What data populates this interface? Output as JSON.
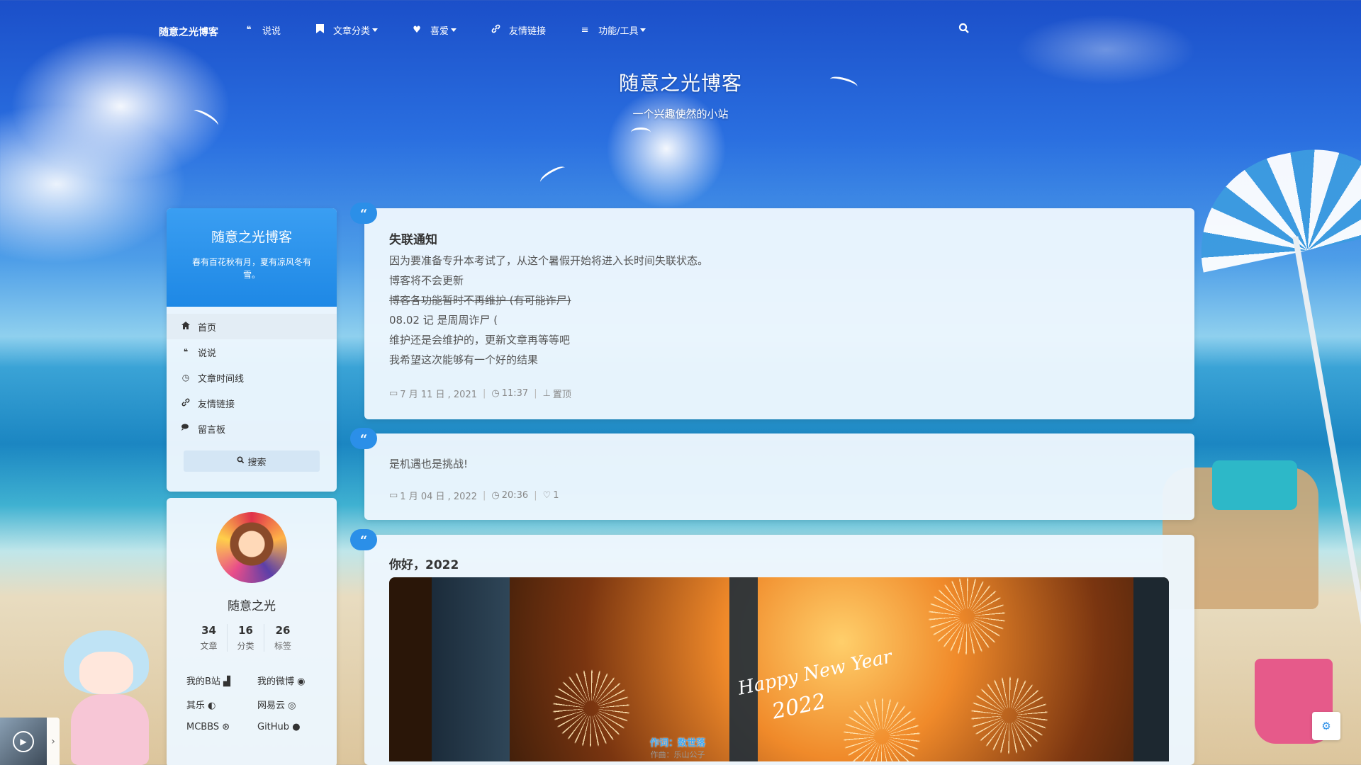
{
  "navbar": {
    "brand": "随意之光博客",
    "items": [
      {
        "label": "说说",
        "icon": "quote-icon",
        "glyph": "❝",
        "caret": false
      },
      {
        "label": "文章分类",
        "icon": "bookmark-icon",
        "glyph": "🔖",
        "caret": true
      },
      {
        "label": "喜爱",
        "icon": "heart-icon",
        "glyph": "♥",
        "caret": true
      },
      {
        "label": "友情链接",
        "icon": "link-icon",
        "glyph": "🔗",
        "caret": false
      },
      {
        "label": "功能/工具",
        "icon": "list-icon",
        "glyph": "≡",
        "caret": true
      }
    ],
    "search_icon": "search-icon"
  },
  "header": {
    "title": "随意之光博客",
    "subtitle": "一个兴趣使然的小站"
  },
  "sidebar": {
    "title": "随意之光博客",
    "description": "春有百花秋有月，夏有凉风冬有雪。",
    "menu": [
      {
        "label": "首页",
        "icon": "home-icon",
        "glyph": "⌂"
      },
      {
        "label": "说说",
        "icon": "quote-icon",
        "glyph": "❝"
      },
      {
        "label": "文章时间线",
        "icon": "clock-icon",
        "glyph": "◷"
      },
      {
        "label": "友情链接",
        "icon": "link-icon",
        "glyph": "🔗"
      },
      {
        "label": "留言板",
        "icon": "comments-icon",
        "glyph": "💬"
      }
    ],
    "search_label": "搜索"
  },
  "profile": {
    "name": "随意之光",
    "stats": [
      {
        "num": "34",
        "label": "文章"
      },
      {
        "num": "16",
        "label": "分类"
      },
      {
        "num": "26",
        "label": "标签"
      }
    ],
    "links": [
      "我的B站",
      "我的微博",
      "其乐",
      "网易云",
      "MCBBS",
      "GitHub"
    ]
  },
  "posts": [
    {
      "title": "失联通知",
      "lines": [
        "因为要准备专升本考试了，从这个暑假开始将进入长时间失联状态。",
        "博客将不会更新",
        "博客各功能暂时不再维护 (有可能诈尸)",
        "08.02 记 是周周诈尸 (",
        "维护还是会维护的，更新文章再等等吧",
        "我希望这次能够有一个好的结果"
      ],
      "date": "7 月 11 日 , 2021",
      "time": "11:37",
      "extra": "置顶"
    },
    {
      "text": "是机遇也是挑战!",
      "date": "1 月 04 日 , 2022",
      "time": "20:36",
      "likes": "1"
    },
    {
      "title": "你好，2022",
      "image_text_1": "Happy New Year",
      "image_text_2": "2022"
    }
  ],
  "lyric": {
    "line1": "作词：数世落",
    "line2": "作曲：乐山公子"
  },
  "colors": {
    "accent": "#2b8fe8",
    "card_bg": "#ecf6fd",
    "sidebar_header": "#1e88e5"
  }
}
